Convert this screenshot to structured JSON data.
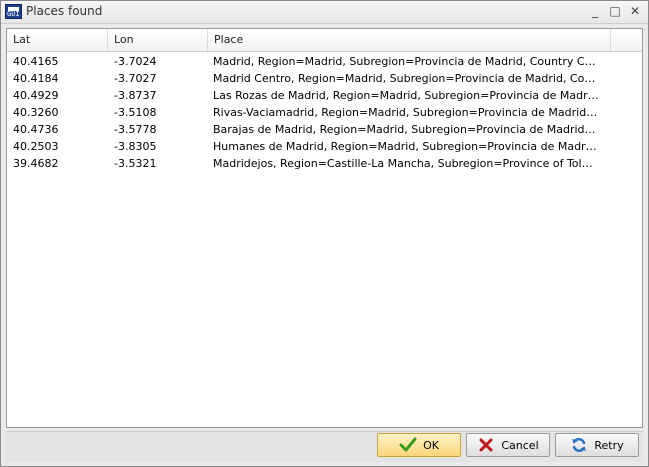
{
  "window": {
    "title": "Places found",
    "icon": "app-icon",
    "icon_text": "GUI"
  },
  "window_controls": {
    "minimize_icon": "minimize-icon",
    "maximize_icon": "maximize-icon",
    "close_icon": "close-icon",
    "minimize_glyph": "_",
    "maximize_glyph": "□",
    "close_glyph": "✕"
  },
  "table": {
    "columns": [
      "Lat",
      "Lon",
      "Place",
      ""
    ],
    "rows": [
      {
        "lat": "40.4165",
        "lon": "-3.7024",
        "place": "Madrid, Region=Madrid, Subregion=Provincia de Madrid, Country Code=ES, ..."
      },
      {
        "lat": "40.4184",
        "lon": "-3.7027",
        "place": "Madrid Centro, Region=Madrid, Subregion=Provincia de Madrid, Country Cod..."
      },
      {
        "lat": "40.4929",
        "lon": "-3.8737",
        "place": "Las Rozas de Madrid, Region=Madrid, Subregion=Provincia de Madrid, Countr..."
      },
      {
        "lat": "40.3260",
        "lon": "-3.5108",
        "place": "Rivas-Vaciamadrid, Region=Madrid, Subregion=Provincia de Madrid, Country ..."
      },
      {
        "lat": "40.4736",
        "lon": "-3.5778",
        "place": "Barajas de Madrid, Region=Madrid, Subregion=Provincia de Madrid, Country ..."
      },
      {
        "lat": "40.2503",
        "lon": "-3.8305",
        "place": "Humanes de Madrid, Region=Madrid, Subregion=Provincia de Madrid, Countr..."
      },
      {
        "lat": "39.4682",
        "lon": "-3.5321",
        "place": "Madridejos, Region=Castille-La Mancha, Subregion=Province of Toledo, Coun..."
      }
    ]
  },
  "buttons": {
    "ok": {
      "label": "OK",
      "icon": "checkmark-icon",
      "color": "#3a9a1c"
    },
    "cancel": {
      "label": "Cancel",
      "icon": "x-icon",
      "color": "#c0151c"
    },
    "retry": {
      "label": "Retry",
      "icon": "refresh-icon",
      "color": "#2a6fc6"
    }
  },
  "colors": {
    "ok_highlight": "#fbd57a",
    "grid_background": "#ffffff",
    "window_background": "#eaeaea"
  }
}
